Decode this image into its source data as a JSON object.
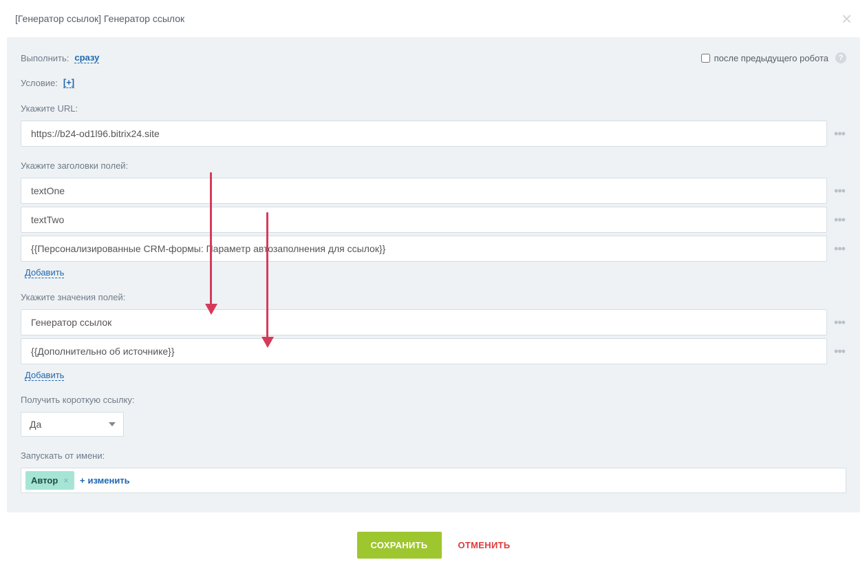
{
  "header": {
    "title": "[Генератор ссылок] Генератор ссылок"
  },
  "top": {
    "execute_label": "Выполнить:",
    "execute_value": "сразу",
    "after_previous_label": "после предыдущего робота"
  },
  "condition": {
    "label": "Условие:",
    "add": "[+]"
  },
  "url": {
    "label": "Укажите URL:",
    "value": "https://b24-od1l96.bitrix24.site"
  },
  "headers": {
    "label": "Укажите заголовки полей:",
    "items": [
      "textOne",
      "textTwo",
      "{{Персонализированные CRM-формы: Параметр автозаполнения для ссылок}}"
    ],
    "add": "Добавить"
  },
  "values": {
    "label": "Укажите значения полей:",
    "items": [
      "Генератор ссылок",
      "{{Дополнительно об источнике}}"
    ],
    "add": "Добавить"
  },
  "short": {
    "label": "Получить короткую ссылку:",
    "selected": "Да"
  },
  "runas": {
    "label": "Запускать от имени:",
    "tag": "Автор",
    "change": "изменить"
  },
  "footer": {
    "save": "СОХРАНИТЬ",
    "cancel": "ОТМЕНИТЬ"
  }
}
